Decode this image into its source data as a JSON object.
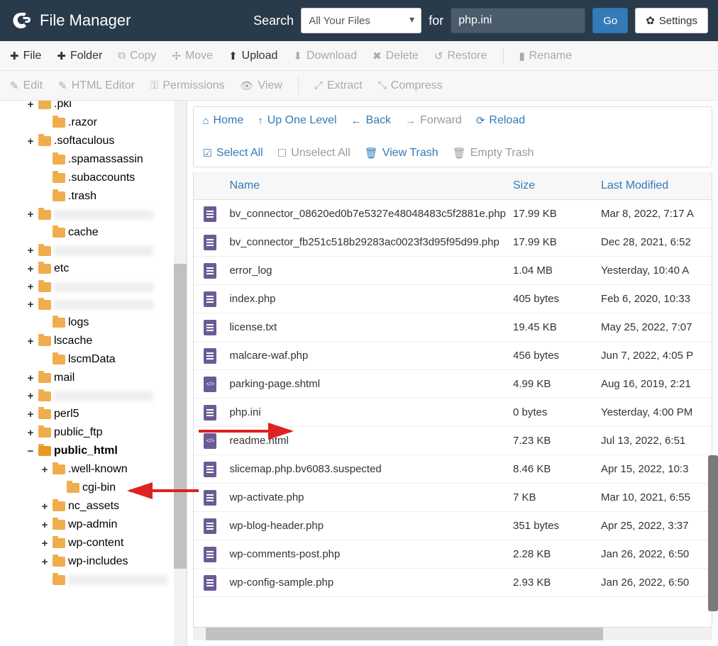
{
  "header": {
    "title": "File Manager",
    "search_label": "Search",
    "search_select": "All Your Files",
    "for_label": "for",
    "search_value": "php.ini",
    "go": "Go",
    "settings": "Settings"
  },
  "toolbar1": {
    "file": "File",
    "folder": "Folder",
    "copy": "Copy",
    "move": "Move",
    "upload": "Upload",
    "download": "Download",
    "delete": "Delete",
    "restore": "Restore",
    "rename": "Rename"
  },
  "toolbar2": {
    "edit": "Edit",
    "html_editor": "HTML Editor",
    "permissions": "Permissions",
    "view": "View",
    "extract": "Extract",
    "compress": "Compress"
  },
  "nav": {
    "home": "Home",
    "up": "Up One Level",
    "back": "Back",
    "forward": "Forward",
    "reload": "Reload",
    "select_all": "Select All",
    "unselect_all": "Unselect All",
    "view_trash": "View Trash",
    "empty_trash": "Empty Trash"
  },
  "columns": {
    "name": "Name",
    "size": "Size",
    "modified": "Last Modified"
  },
  "tree": [
    {
      "indent": 1,
      "toggle": "+",
      "name": ".pki",
      "blur": false,
      "cut": true
    },
    {
      "indent": 2,
      "toggle": "",
      "name": ".razor"
    },
    {
      "indent": 1,
      "toggle": "+",
      "name": ".softaculous"
    },
    {
      "indent": 2,
      "toggle": "",
      "name": ".spamassassin"
    },
    {
      "indent": 2,
      "toggle": "",
      "name": ".subaccounts"
    },
    {
      "indent": 2,
      "toggle": "",
      "name": ".trash"
    },
    {
      "indent": 1,
      "toggle": "+",
      "name": "",
      "blur": true
    },
    {
      "indent": 2,
      "toggle": "",
      "name": "cache"
    },
    {
      "indent": 1,
      "toggle": "+",
      "name": "",
      "blur": true
    },
    {
      "indent": 1,
      "toggle": "+",
      "name": "etc"
    },
    {
      "indent": 1,
      "toggle": "+",
      "name": "",
      "blur": true
    },
    {
      "indent": 1,
      "toggle": "+",
      "name": "",
      "blur": true
    },
    {
      "indent": 2,
      "toggle": "",
      "name": "logs"
    },
    {
      "indent": 1,
      "toggle": "+",
      "name": "lscache"
    },
    {
      "indent": 2,
      "toggle": "",
      "name": "lscmData"
    },
    {
      "indent": 1,
      "toggle": "+",
      "name": "mail"
    },
    {
      "indent": 1,
      "toggle": "+",
      "name": "",
      "blur": true
    },
    {
      "indent": 1,
      "toggle": "+",
      "name": "perl5"
    },
    {
      "indent": 1,
      "toggle": "+",
      "name": "public_ftp"
    },
    {
      "indent": 1,
      "toggle": "−",
      "name": "public_html",
      "bold": true,
      "open": true
    },
    {
      "indent": 2,
      "toggle": "+",
      "name": ".well-known"
    },
    {
      "indent": 3,
      "toggle": "",
      "name": "cgi-bin"
    },
    {
      "indent": 2,
      "toggle": "+",
      "name": "nc_assets"
    },
    {
      "indent": 2,
      "toggle": "+",
      "name": "wp-admin"
    },
    {
      "indent": 2,
      "toggle": "+",
      "name": "wp-content"
    },
    {
      "indent": 2,
      "toggle": "+",
      "name": "wp-includes"
    },
    {
      "indent": 2,
      "toggle": "",
      "name": "",
      "blur": true
    }
  ],
  "files": [
    {
      "name": "bv_connector_08620ed0b7e5327e48048483c5f2881e.php",
      "size": "17.99 KB",
      "date": "Mar 8, 2022, 7:17 A",
      "icon": "doc"
    },
    {
      "name": "bv_connector_fb251c518b29283ac0023f3d95f95d99.php",
      "size": "17.99 KB",
      "date": "Dec 28, 2021, 6:52",
      "icon": "doc"
    },
    {
      "name": "error_log",
      "size": "1.04 MB",
      "date": "Yesterday, 10:40 A",
      "icon": "doc"
    },
    {
      "name": "index.php",
      "size": "405 bytes",
      "date": "Feb 6, 2020, 10:33",
      "icon": "doc"
    },
    {
      "name": "license.txt",
      "size": "19.45 KB",
      "date": "May 25, 2022, 7:07",
      "icon": "doc"
    },
    {
      "name": "malcare-waf.php",
      "size": "456 bytes",
      "date": "Jun 7, 2022, 4:05 P",
      "icon": "doc"
    },
    {
      "name": "parking-page.shtml",
      "size": "4.99 KB",
      "date": "Aug 16, 2019, 2:21",
      "icon": "code"
    },
    {
      "name": "php.ini",
      "size": "0 bytes",
      "date": "Yesterday, 4:00 PM",
      "icon": "doc"
    },
    {
      "name": "readme.html",
      "size": "7.23 KB",
      "date": "Jul 13, 2022, 6:51",
      "icon": "code"
    },
    {
      "name": "slicemap.php.bv6083.suspected",
      "size": "8.46 KB",
      "date": "Apr 15, 2022, 10:3",
      "icon": "doc"
    },
    {
      "name": "wp-activate.php",
      "size": "7 KB",
      "date": "Mar 10, 2021, 6:55",
      "icon": "doc"
    },
    {
      "name": "wp-blog-header.php",
      "size": "351 bytes",
      "date": "Apr 25, 2022, 3:37",
      "icon": "doc"
    },
    {
      "name": "wp-comments-post.php",
      "size": "2.28 KB",
      "date": "Jan 26, 2022, 6:50",
      "icon": "doc"
    },
    {
      "name": "wp-config-sample.php",
      "size": "2.93 KB",
      "date": "Jan 26, 2022, 6:50",
      "icon": "doc"
    }
  ]
}
